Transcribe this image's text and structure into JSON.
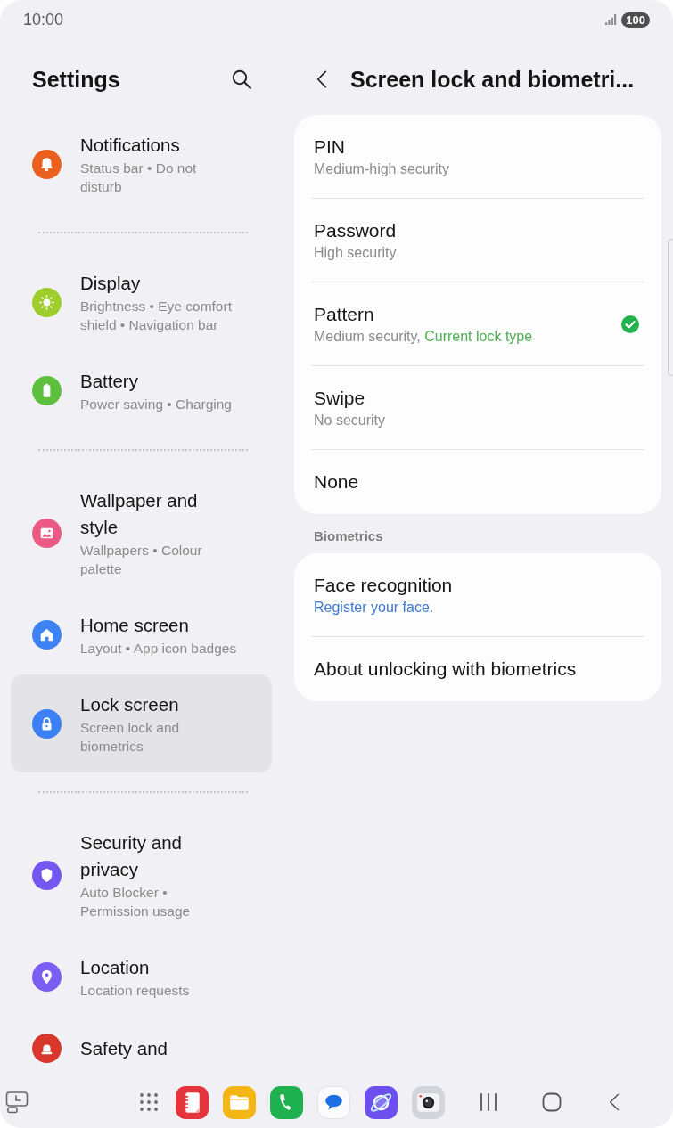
{
  "status_bar": {
    "time": "10:00",
    "battery": "100"
  },
  "sidebar": {
    "title": "Settings",
    "groups": [
      {
        "items": [
          {
            "title": "Notifications",
            "summary": "Status bar • Do not disturb",
            "color": "#e9601f",
            "selected": false
          }
        ]
      },
      {
        "items": [
          {
            "title": "Display",
            "summary": "Brightness • Eye comfort shield • Navigation bar",
            "color": "#9fcd2c",
            "selected": false
          },
          {
            "title": "Battery",
            "summary": "Power saving • Charging",
            "color": "#5cbf3d",
            "selected": false
          }
        ]
      },
      {
        "items": [
          {
            "title": "Wallpaper and style",
            "summary": "Wallpapers • Colour palette",
            "color": "#ea5a85",
            "selected": false
          },
          {
            "title": "Home screen",
            "summary": "Layout • App icon badges",
            "color": "#3d83f5",
            "selected": false
          },
          {
            "title": "Lock screen",
            "summary": "Screen lock and biometrics",
            "color": "#3b80f4",
            "selected": true
          }
        ]
      },
      {
        "items": [
          {
            "title": "Security and privacy",
            "summary": "Auto Blocker • Permission usage",
            "color": "#7457f0",
            "selected": false
          },
          {
            "title": "Location",
            "summary": "Location requests",
            "color": "#7a5df3",
            "selected": false
          },
          {
            "title": "Safety and",
            "color": "#d9372b",
            "selected": false
          }
        ]
      }
    ]
  },
  "detail": {
    "title": "Screen lock and biometri...",
    "lock_types": [
      {
        "title": "PIN",
        "description": "Medium-high security",
        "selected": false
      },
      {
        "title": "Password",
        "description": "High security",
        "selected": false
      },
      {
        "title": "Pattern",
        "description": "Medium security,",
        "status": "Current lock type",
        "selected": true
      },
      {
        "title": "Swipe",
        "description": "No security",
        "selected": false
      },
      {
        "title": "None",
        "selected": false
      }
    ],
    "section_label": "Biometrics",
    "biometrics": [
      {
        "title": "Face recognition",
        "description": "Register your face."
      },
      {
        "title": "About unlocking with biometrics"
      }
    ]
  }
}
